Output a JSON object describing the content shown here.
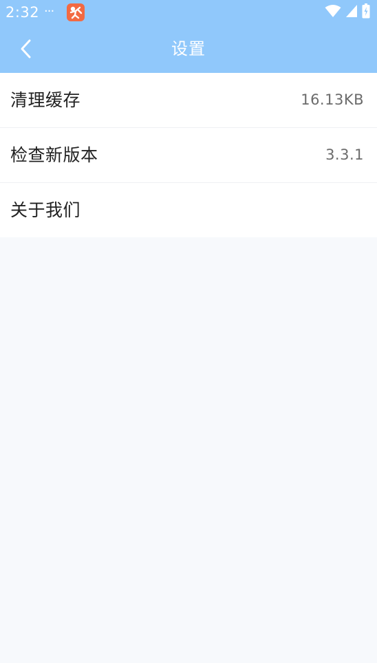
{
  "status_bar": {
    "time": "2:32",
    "dots": "···",
    "app_icon": "app-notification-icon",
    "icons": [
      "wifi-icon",
      "signal-icon",
      "battery-charging-icon"
    ]
  },
  "header": {
    "title": "设置",
    "back_icon": "chevron-left-icon",
    "background": "#90c8fb"
  },
  "settings": {
    "items": [
      {
        "label": "清理缓存",
        "value": "16.13KB"
      },
      {
        "label": "检查新版本",
        "value": "3.3.1"
      },
      {
        "label": "关于我们",
        "value": ""
      }
    ]
  },
  "colors": {
    "accent": "#90c8fb",
    "page_background": "#f7f9fc",
    "text_primary": "#222222",
    "text_secondary": "#6b6b6b"
  }
}
